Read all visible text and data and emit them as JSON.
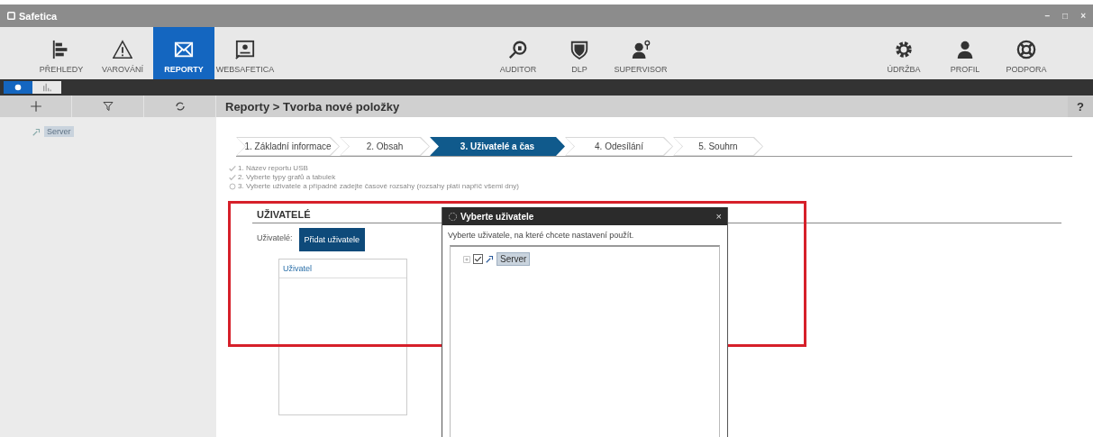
{
  "window": {
    "title": "Safetica",
    "controls": [
      "–",
      "□",
      "×"
    ]
  },
  "toolbar": {
    "left": [
      {
        "label": "PŘEHLEDY",
        "selected": false
      },
      {
        "label": "VAROVÁNÍ",
        "selected": false
      },
      {
        "label": "REPORTY",
        "selected": true
      },
      {
        "label": "WEBSAFETICA",
        "selected": false
      }
    ],
    "center": [
      {
        "label": "AUDITOR",
        "selected": false
      },
      {
        "label": "DLP",
        "selected": false
      },
      {
        "label": "SUPERVISOR",
        "selected": false
      }
    ],
    "right": [
      {
        "label": "ÚDRŽBA",
        "selected": false
      },
      {
        "label": "PROFIL",
        "selected": false
      },
      {
        "label": "PODPORA",
        "selected": false
      }
    ]
  },
  "mode_tabs": [
    {
      "selected": true
    },
    {
      "selected": false
    }
  ],
  "sidebar": {
    "tree": [
      {
        "label": "Server",
        "selected": true
      }
    ]
  },
  "breadcrumb": "Reporty > Tvorba nové položky",
  "help": "?",
  "steps": [
    {
      "label": "1. Základní informace",
      "selected": false
    },
    {
      "label": "2. Obsah",
      "selected": false
    },
    {
      "label": "3. Uživatelé a čas",
      "selected": true
    },
    {
      "label": "4. Odesílání",
      "selected": false
    },
    {
      "label": "5. Souhrn",
      "selected": false
    }
  ],
  "checklist": [
    {
      "text": "1. Název reportu USB",
      "done": true
    },
    {
      "text": "2. Vyberte typy grafů a tabulek",
      "done": true
    },
    {
      "text": "3. Vyberte uživatele a případně zadejte časové rozsahy (rozsahy platí napříč všemi dny)",
      "done": false
    }
  ],
  "section": {
    "title": "UŽIVATELÉ",
    "users_label": "Uživatelé:",
    "add_button": "Přidat uživatele",
    "list_header": "Uživatel"
  },
  "dialog": {
    "title": "Vyberte uživatele",
    "close": "×",
    "prompt": "Vyberte uživatele, na které chcete nastavení použít.",
    "tree": [
      {
        "label": "Server",
        "checked": true,
        "selected": true,
        "expanded": false
      }
    ]
  }
}
